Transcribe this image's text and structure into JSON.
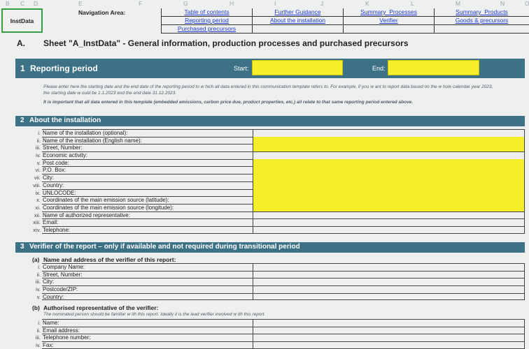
{
  "column_headers": [
    "B",
    "C",
    "D",
    "E",
    "F",
    "G",
    "H",
    "I",
    "J",
    "K",
    "L",
    "M",
    "N",
    "O"
  ],
  "sheet_tab": "InstData",
  "nav": {
    "label": "Navigation Area:",
    "links": [
      [
        "Table of contents",
        "Further Guidance",
        "Summary_Processes",
        "Summary_Products"
      ],
      [
        "Reporting period",
        "About the installation",
        "Verifier",
        "Goods & precursors"
      ],
      [
        "Purchased precursors",
        "",
        "",
        ""
      ]
    ]
  },
  "section": {
    "letter": "A.",
    "title": "Sheet \"A_InstData\" - General information, production processes and purchased precursors"
  },
  "reporting_period": {
    "num": "1",
    "title": "Reporting period",
    "start_label": "Start:",
    "end_label": "End:",
    "start_value": "",
    "end_value": "",
    "note1": "Please enter here the starting date and the end date of the reporting period to w hich all data entered in this communication template refers to. For example, if you w ant to report data based on the w hole calendar year 2023,",
    "note2": "the starting date w ould be 1.1.2023 and the end date 31.12.2023.",
    "note3": "It is important that all data entered in this template (embedded emissions, carbon price due, product properties, etc.) all relate to that same reporting period entered above."
  },
  "installation": {
    "num": "2",
    "title": "About the installation",
    "rows": [
      {
        "rn": "i.",
        "label": "Name of the installation (optional):",
        "yellow": false
      },
      {
        "rn": "ii.",
        "label": "Name of the installation (English name):",
        "yellow": true
      },
      {
        "rn": "iii.",
        "label": "Street, Number:",
        "yellow": true
      },
      {
        "rn": "iv.",
        "label": "Economic activity:",
        "yellow": false
      },
      {
        "rn": "v.",
        "label": "Post code:",
        "yellow": true
      },
      {
        "rn": "vi.",
        "label": "P.O. Box:",
        "yellow": true
      },
      {
        "rn": "vii.",
        "label": "City:",
        "yellow": true
      },
      {
        "rn": "viii.",
        "label": "Country:",
        "yellow": true
      },
      {
        "rn": "ix.",
        "label": "UNLOCODE:",
        "yellow": true
      },
      {
        "rn": "x.",
        "label": "Coordinates of the main emission source (latitude):",
        "yellow": true
      },
      {
        "rn": "xi.",
        "label": "Coordinates of the main emission source (longitude):",
        "yellow": true
      },
      {
        "rn": "xii.",
        "label": "Name of authorized representative:",
        "yellow": false
      },
      {
        "rn": "xiii.",
        "label": "Email:",
        "yellow": false
      },
      {
        "rn": "xiv.",
        "label": "Telephone:",
        "yellow": false
      }
    ]
  },
  "verifier": {
    "num": "3",
    "title": "Verifier of the report – only if available and not required during transitional period",
    "a_label": "(a)",
    "a_title": "Name and address of the verifier of this report:",
    "a_rows": [
      {
        "rn": "i.",
        "label": "Company Name:"
      },
      {
        "rn": "ii.",
        "label": "Street, Number:"
      },
      {
        "rn": "iii.",
        "label": "City:"
      },
      {
        "rn": "iv.",
        "label": "Postcode/ZIP:"
      },
      {
        "rn": "v.",
        "label": "Country:"
      }
    ],
    "b_label": "(b)",
    "b_title": "Authorised representative of the verifier:",
    "b_note": "The nominated person should be familiar w ith this report. Ideally it is the lead verifier involved w ith this report.",
    "b_rows": [
      {
        "rn": "i.",
        "label": "Name:"
      },
      {
        "rn": "ii.",
        "label": "Email address:"
      },
      {
        "rn": "iii.",
        "label": "Telephone number:"
      },
      {
        "rn": "iv.",
        "label": "Fax:"
      }
    ]
  }
}
